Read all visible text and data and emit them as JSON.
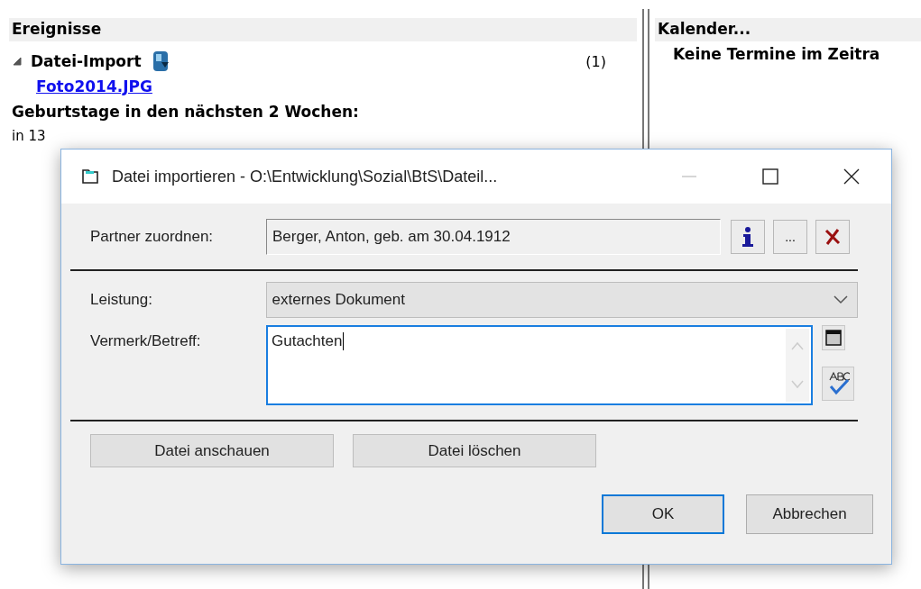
{
  "events": {
    "title": "Ereignisse",
    "group": {
      "label": "Datei-Import",
      "expanded": true,
      "count": "(1)",
      "link": "Foto2014.JPG"
    },
    "birthdays_heading": "Geburtstage in den nächsten 2 Wochen:",
    "birthday_text": "in 13"
  },
  "calendar": {
    "title": "Kalender...",
    "message": "Keine Termine im Zeitra"
  },
  "dialog": {
    "title": "Datei importieren - O:\\Entwicklung\\Sozial\\BtS\\Dateil...",
    "partner": {
      "label": "Partner zuordnen:",
      "value": "Berger, Anton, geb. am 30.04.1912",
      "more_button": "..."
    },
    "leistung": {
      "label": "Leistung:",
      "value": "externes Dokument"
    },
    "vermerk": {
      "label": "Vermerk/Betreff:",
      "value": "Gutachten",
      "focused": true
    },
    "file_buttons": [
      "Datei anschauen",
      "Datei löschen"
    ],
    "buttons": [
      {
        "label": "OK",
        "default": true
      },
      {
        "label": "Abbrechen",
        "default": false
      }
    ]
  }
}
